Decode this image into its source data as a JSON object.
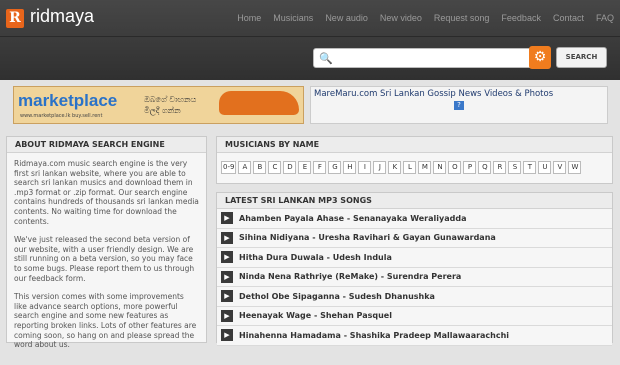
{
  "header": {
    "logo_letter": "R",
    "logo_text": "ridmaya",
    "nav": [
      "Home",
      "Musicians",
      "New audio",
      "New video",
      "Request song",
      "Feedback",
      "Contact",
      "FAQ"
    ]
  },
  "search": {
    "placeholder": "",
    "button_label": "SEARCH",
    "search_icon": "search-icon",
    "gear_icon": "settings-icon"
  },
  "banner": {
    "brand": "marketplace",
    "url": "www.marketplace.lk buy.sell.rent",
    "sinhala": "ඔබගේ වාහනය මිලදී ගන්න"
  },
  "ad": {
    "text": "MareMaru.com Sri Lankan Gossip News Videos & Photos",
    "badge": "?"
  },
  "about": {
    "heading": "ABOUT RIDMAYA SEARCH ENGINE",
    "paragraphs": [
      "Ridmaya.com music search engine is the very first sri lankan website, where you are able to search sri lankan musics and download them in .mp3 format or .zip format. Our search engine contains hundreds of thousands sri lankan media contents. No waiting time for download the contents.",
      "We've just released the second beta version of our website, with a user friendly design. We are still running on a beta version, so you may face to some bugs. Please report them to us through our feedback form.",
      "This version comes with some improvements like advance search options, more powerful search engine and some new features as reporting broken links. Lots of other features are coming soon, so hang on and please spread the word about us."
    ]
  },
  "musicians": {
    "heading": "MUSICIANS BY NAME",
    "letters": [
      "0-9",
      "A",
      "B",
      "C",
      "D",
      "E",
      "F",
      "G",
      "H",
      "I",
      "J",
      "K",
      "L",
      "M",
      "N",
      "O",
      "P",
      "Q",
      "R",
      "S",
      "T",
      "U",
      "V",
      "W"
    ]
  },
  "songs": {
    "heading": "LATEST SRI LANKAN MP3 SONGS",
    "items": [
      "Ahamben Payala Ahase - Senanayaka Weraliyadda",
      "Sihina Nidiyana - Uresha Ravihari & Gayan Gunawardana",
      "Hitha Dura Duwala - Udesh Indula",
      "Ninda Nena Rathriye (ReMake) - Surendra Perera",
      "Dethol Obe Sipaganna - Sudesh Dhanushka",
      "Heenayak Wage - Shehan Pasquel",
      "Hinahenna Hamadama - Shashika Pradeep Mallawaarachchi"
    ]
  }
}
